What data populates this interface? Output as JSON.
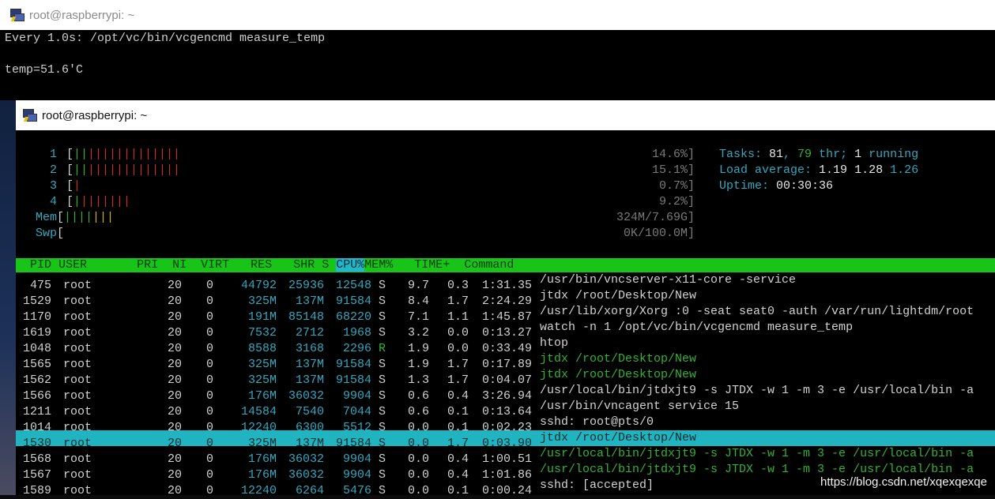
{
  "back_window": {
    "title": "root@raspberrypi: ~",
    "watch_line": "Every 1.0s: /opt/vc/bin/vcgencmd measure_temp",
    "temp_line": "temp=51.6'C"
  },
  "front_window": {
    "title": "root@raspberrypi: ~",
    "meters": [
      {
        "label": "1",
        "bars_green": "",
        "bars_red": "|||||||||||||",
        "bars_green_pre": "||",
        "value": "14.6%]"
      },
      {
        "label": "2",
        "bars_green_pre": "||",
        "bars_red": "|||||||||||||",
        "value": "15.1%]"
      },
      {
        "label": "3",
        "bars_green_pre": "",
        "bars_red": "|",
        "value": "0.7%]"
      },
      {
        "label": "4",
        "bars_green_pre": "|",
        "bars_red": "|||||||",
        "value": "9.2%]"
      },
      {
        "label": "Mem",
        "bars_green_pre": "||||",
        "bars_red": "",
        "bars_yellow": "|||",
        "value": "324M/7.69G]"
      },
      {
        "label": "Swp",
        "bars_green_pre": "",
        "bars_red": "",
        "value": "0K/100.0M]"
      }
    ],
    "stats": {
      "tasks_label": "Tasks: ",
      "tasks_value": "81",
      "tasks_sep": ", ",
      "thr_value": "79",
      "thr_label": " thr; ",
      "running_value": "1",
      "running_label": " running",
      "load_label": "Load average: ",
      "load1": "1.19",
      "load5": "1.28",
      "load15": "1.26",
      "uptime_label": "Uptime: ",
      "uptime_value": "00:30:36"
    },
    "header": {
      "pid": "  PID",
      "user": "USER",
      "pri": "PRI",
      "ni": "NI",
      "virt": "VIRT",
      "res": "RES",
      "shr": "SHR",
      "s": "S",
      "cpu": "CPU%",
      "mem": "MEM%",
      "time": "TIME+",
      "command": "Command"
    },
    "processes": [
      {
        "pid": "475",
        "user": "root",
        "pri": "20",
        "ni": "0",
        "virt": "44792",
        "res": "25936",
        "shr": "12548",
        "s": "S",
        "cpu": "9.7",
        "mem": "0.3",
        "time": "1:31.35",
        "command": "/usr/bin/vncserver-x11-core -service",
        "green": false
      },
      {
        "pid": "1529",
        "user": "root",
        "pri": "20",
        "ni": "0",
        "virt": "325M",
        "res": "137M",
        "shr": "91584",
        "s": "S",
        "cpu": "8.4",
        "mem": "1.7",
        "time": "2:24.29",
        "command": "jtdx /root/Desktop/New",
        "green": false
      },
      {
        "pid": "1170",
        "user": "root",
        "pri": "20",
        "ni": "0",
        "virt": "191M",
        "res": "85148",
        "shr": "68220",
        "s": "S",
        "cpu": "7.1",
        "mem": "1.1",
        "time": "1:45.87",
        "command": "/usr/lib/xorg/Xorg :0 -seat seat0 -auth /var/run/lightdm/root",
        "green": false
      },
      {
        "pid": "1619",
        "user": "root",
        "pri": "20",
        "ni": "0",
        "virt": "7532",
        "res": "2712",
        "shr": "1968",
        "s": "S",
        "cpu": "3.2",
        "mem": "0.0",
        "time": "0:13.27",
        "command": "watch -n 1 /opt/vc/bin/vcgencmd measure_temp",
        "green": false
      },
      {
        "pid": "1048",
        "user": "root",
        "pri": "20",
        "ni": "0",
        "virt": "8588",
        "res": "3168",
        "shr": "2296",
        "s": "R",
        "cpu": "1.9",
        "mem": "0.0",
        "time": "0:33.49",
        "command": "htop",
        "green": false
      },
      {
        "pid": "1565",
        "user": "root",
        "pri": "20",
        "ni": "0",
        "virt": "325M",
        "res": "137M",
        "shr": "91584",
        "s": "S",
        "cpu": "1.9",
        "mem": "1.7",
        "time": "0:17.89",
        "command": "jtdx /root/Desktop/New",
        "green": true
      },
      {
        "pid": "1562",
        "user": "root",
        "pri": "20",
        "ni": "0",
        "virt": "325M",
        "res": "137M",
        "shr": "91584",
        "s": "S",
        "cpu": "1.3",
        "mem": "1.7",
        "time": "0:04.07",
        "command": "jtdx /root/Desktop/New",
        "green": true
      },
      {
        "pid": "1566",
        "user": "root",
        "pri": "20",
        "ni": "0",
        "virt": "176M",
        "res": "36032",
        "shr": "9904",
        "s": "S",
        "cpu": "0.6",
        "mem": "0.4",
        "time": "3:26.94",
        "command": "/usr/local/bin/jtdxjt9 -s JTDX -w 1 -m 3 -e /usr/local/bin -a",
        "green": false
      },
      {
        "pid": "1211",
        "user": "root",
        "pri": "20",
        "ni": "0",
        "virt": "14584",
        "res": "7540",
        "shr": "7044",
        "s": "S",
        "cpu": "0.6",
        "mem": "0.1",
        "time": "0:13.64",
        "command": "/usr/bin/vncagent service 15",
        "green": false
      },
      {
        "pid": "1014",
        "user": "root",
        "pri": "20",
        "ni": "0",
        "virt": "12240",
        "res": "6300",
        "shr": "5512",
        "s": "S",
        "cpu": "0.0",
        "mem": "0.1",
        "time": "0:02.23",
        "command": "sshd: root@pts/0",
        "green": false
      },
      {
        "pid": "1530",
        "user": "root",
        "pri": "20",
        "ni": "0",
        "virt": "325M",
        "res": "137M",
        "shr": "91584",
        "s": "S",
        "cpu": "0.0",
        "mem": "1.7",
        "time": "0:03.90",
        "command": "jtdx /root/Desktop/New",
        "green": false,
        "selected": true
      },
      {
        "pid": "1568",
        "user": "root",
        "pri": "20",
        "ni": "0",
        "virt": "176M",
        "res": "36032",
        "shr": "9904",
        "s": "S",
        "cpu": "0.0",
        "mem": "0.4",
        "time": "1:00.51",
        "command": "/usr/local/bin/jtdxjt9 -s JTDX -w 1 -m 3 -e /usr/local/bin -a",
        "green": true
      },
      {
        "pid": "1567",
        "user": "root",
        "pri": "20",
        "ni": "0",
        "virt": "176M",
        "res": "36032",
        "shr": "9904",
        "s": "S",
        "cpu": "0.0",
        "mem": "0.4",
        "time": "1:01.86",
        "command": "/usr/local/bin/jtdxjt9 -s JTDX -w 1 -m 3 -e /usr/local/bin -a",
        "green": true
      },
      {
        "pid": "1589",
        "user": "root",
        "pri": "20",
        "ni": "0",
        "virt": "12240",
        "res": "6264",
        "shr": "5476",
        "s": "S",
        "cpu": "0.0",
        "mem": "0.1",
        "time": "0:00.24",
        "command": "sshd: [accepted]",
        "green": false
      }
    ]
  },
  "watermark": "https://blog.csdn.net/xqexqexqe"
}
